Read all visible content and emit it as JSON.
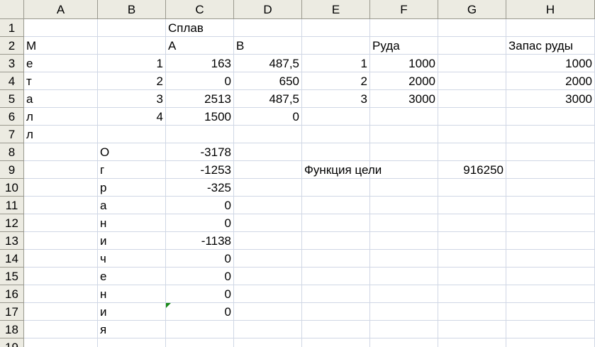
{
  "columns": [
    "A",
    "B",
    "C",
    "D",
    "E",
    "F",
    "G",
    "H"
  ],
  "rows": [
    "1",
    "2",
    "3",
    "4",
    "5",
    "6",
    "7",
    "8",
    "9",
    "10",
    "11",
    "12",
    "13",
    "14",
    "15",
    "16",
    "17",
    "18",
    "19"
  ],
  "cells": {
    "C1": "Сплав",
    "A2": "М",
    "C2": "A",
    "D2": "B",
    "F2": "Руда",
    "H2": "Запас руды",
    "A3": "е",
    "B3": "1",
    "C3": "163",
    "D3": "487,5",
    "E3": "1",
    "F3": "1000",
    "H3": "1000",
    "A4": "т",
    "B4": "2",
    "C4": "0",
    "D4": "650",
    "E4": "2",
    "F4": "2000",
    "H4": "2000",
    "A5": "а",
    "B5": "3",
    "C5": "2513",
    "D5": "487,5",
    "E5": "3",
    "F5": "3000",
    "H5": "3000",
    "A6": "л",
    "B6": "4",
    "C6": "1500",
    "D6": "0",
    "A7": "л",
    "B8": "О",
    "C8": "-3178",
    "B9": "г",
    "C9": "-1253",
    "E9": "Функция цели",
    "G9": "916250",
    "B10": "р",
    "C10": "-325",
    "B11": "а",
    "C11": "0",
    "B12": "н",
    "C12": "0",
    "B13": "и",
    "C13": "-1138",
    "B14": "ч",
    "C14": "0",
    "B15": "е",
    "C15": "0",
    "B16": "н",
    "C16": "0",
    "B17": "и",
    "C17": "0",
    "B18": "я"
  },
  "colors": {
    "header_bg": "#ecebe2",
    "gridline": "#d0d7e5",
    "header_border": "#9a998f",
    "comment_marker": "#1a8a1a"
  }
}
